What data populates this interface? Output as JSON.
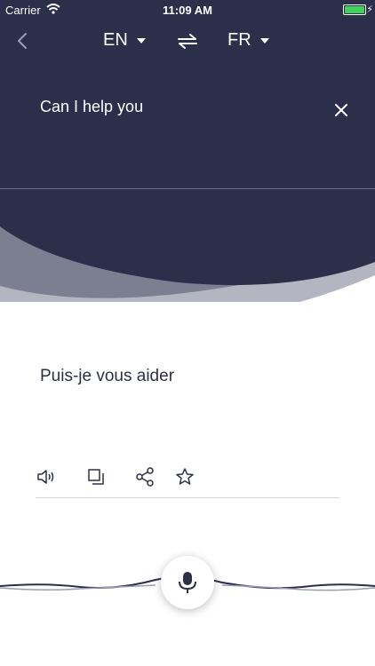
{
  "status": {
    "carrier": "Carrier",
    "time": "11:09 AM"
  },
  "nav": {
    "source_lang": "EN",
    "target_lang": "FR"
  },
  "source": {
    "text": "Can I help you"
  },
  "translation": {
    "text": "Puis-je vous aider"
  },
  "colors": {
    "dark": "#2b2f4a",
    "accent_light": "#b3b5c1",
    "accent_mid": "#7c7f91"
  },
  "icons": [
    "back-icon",
    "swap-icon",
    "close-icon",
    "speaker-icon",
    "copy-icon",
    "share-icon",
    "star-icon",
    "microphone-icon"
  ]
}
